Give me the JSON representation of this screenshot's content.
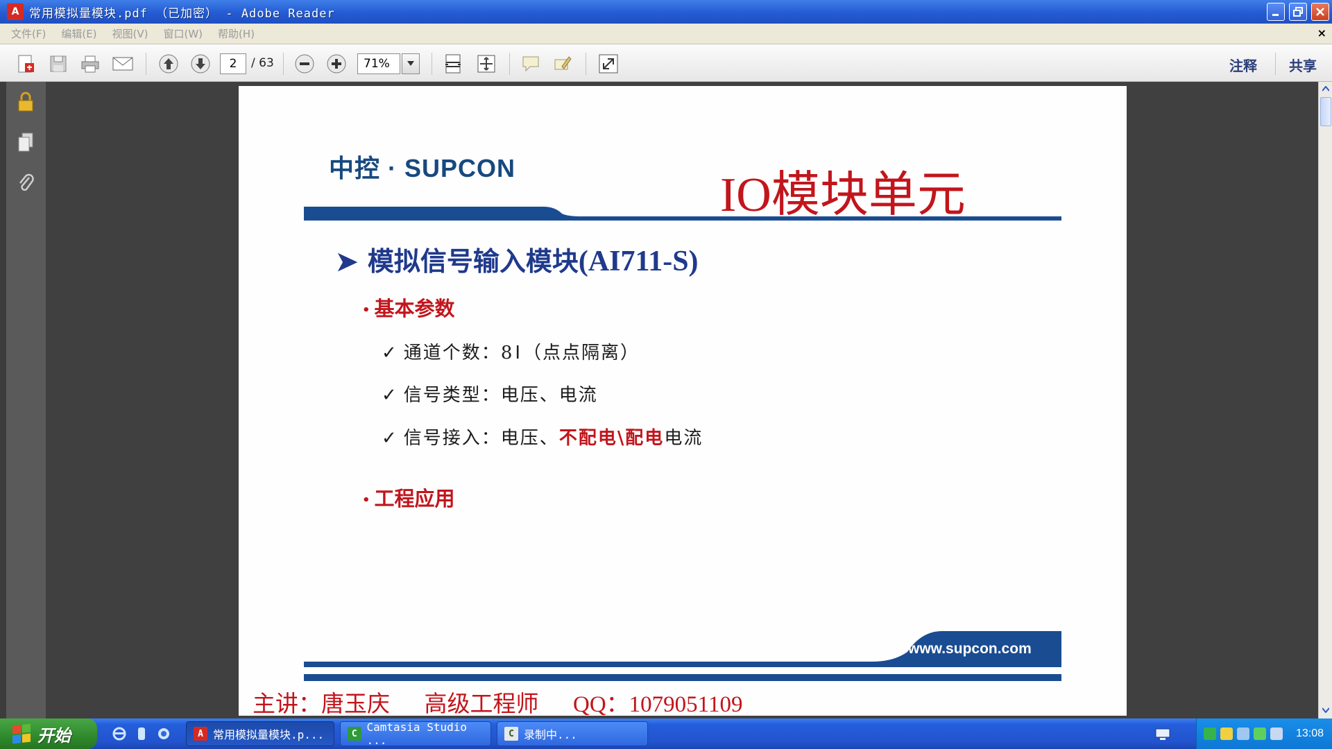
{
  "window": {
    "title": "常用模拟量模块.pdf  （已加密） - Adobe Reader",
    "app_icon_letter": "A"
  },
  "menu": {
    "items": [
      "文件(F)",
      "编辑(E)",
      "视图(V)",
      "窗口(W)",
      "帮助(H)"
    ],
    "close_glyph": "×"
  },
  "toolbar": {
    "current_page": "2",
    "total_pages": "/ 63",
    "zoom": "71%",
    "annotate_label": "注释",
    "share_label": "共享"
  },
  "slide": {
    "logo": "中控 · SUPCON",
    "title": "IO模块单元",
    "heading_arrow": "➤",
    "heading_text": "模拟信号输入模块",
    "heading_model": "(AI711-S)",
    "section1": "基本参数",
    "bullet_glyph": "•",
    "check_glyph": "✓",
    "param1_label": "通道个数：",
    "param1_value": "8",
    "param1_cursor": "I",
    "param1_note": "（点点隔离）",
    "param2_text": "信号类型：电压、电流",
    "param3_label": "信号接入：电压、",
    "param3_red": "不配电\\配电",
    "param3_tail": "电流",
    "section2": "工程应用",
    "url": "www.supcon.com",
    "presenter": "主讲：唐玉庆      高级工程师      QQ：1079051109"
  },
  "taskbar": {
    "start_label": "开始",
    "tasks": [
      {
        "label": "常用模拟量模块.p...",
        "icon_letter": "A"
      },
      {
        "label": "Camtasia Studio ...",
        "icon_letter": "C"
      },
      {
        "label": "录制中...",
        "icon_letter": "C"
      }
    ],
    "clock": "13:08"
  },
  "colors": {
    "slide_red": "#c2151c",
    "slide_blue": "#1f3a8c",
    "band_blue": "#1a4c92"
  }
}
